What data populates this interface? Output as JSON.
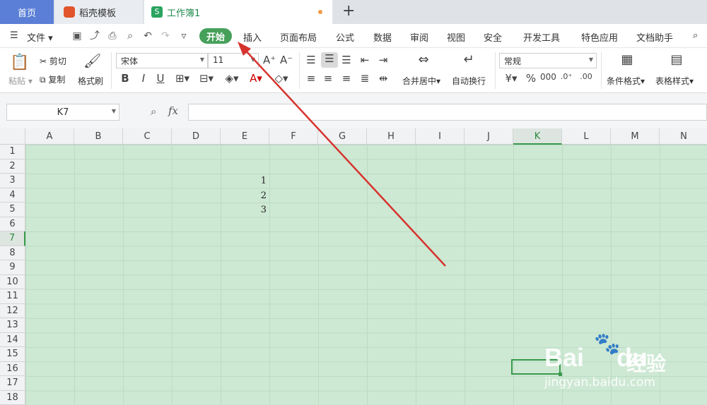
{
  "tabs": {
    "home": "首页",
    "daoke": "稻壳模板",
    "workbook": "工作簿1",
    "new_tab": "+"
  },
  "menu": {
    "file": "文件",
    "items": [
      "开始",
      "插入",
      "页面布局",
      "公式",
      "数据",
      "审阅",
      "视图",
      "安全",
      "开发工具",
      "特色应用",
      "文档助手"
    ]
  },
  "ribbon": {
    "paste": "粘贴",
    "cut": "剪切",
    "copy": "复制",
    "format_painter": "格式刷",
    "font_name": "宋体",
    "font_size": "11",
    "merge_center": "合并居中",
    "wrap_text": "自动换行",
    "number_format": "常规",
    "conditional_format": "条件格式",
    "table_style": "表格样式"
  },
  "formula_bar": {
    "name_box": "K7",
    "fx": "fx",
    "formula": ""
  },
  "grid": {
    "columns": [
      "A",
      "B",
      "C",
      "D",
      "E",
      "F",
      "G",
      "H",
      "I",
      "J",
      "K",
      "L",
      "M",
      "N"
    ],
    "rows": [
      "1",
      "2",
      "3",
      "4",
      "5",
      "6",
      "7",
      "8",
      "9",
      "10",
      "11",
      "12",
      "13",
      "14",
      "15",
      "16",
      "17",
      "18"
    ],
    "selected_column": "K",
    "selected_row": "7",
    "cells": [
      {
        "ref": "E3",
        "value": "1"
      },
      {
        "ref": "E4",
        "value": "2"
      },
      {
        "ref": "E5",
        "value": "3"
      }
    ]
  },
  "watermark": {
    "brand": "Bai",
    "brand2": "du",
    "cn": "经验",
    "url": "jingyan.baidu.com"
  },
  "colors": {
    "accent": "#46a05a",
    "grid_fill": "#cde8d3",
    "annotation_arrow": "#d6332e"
  }
}
